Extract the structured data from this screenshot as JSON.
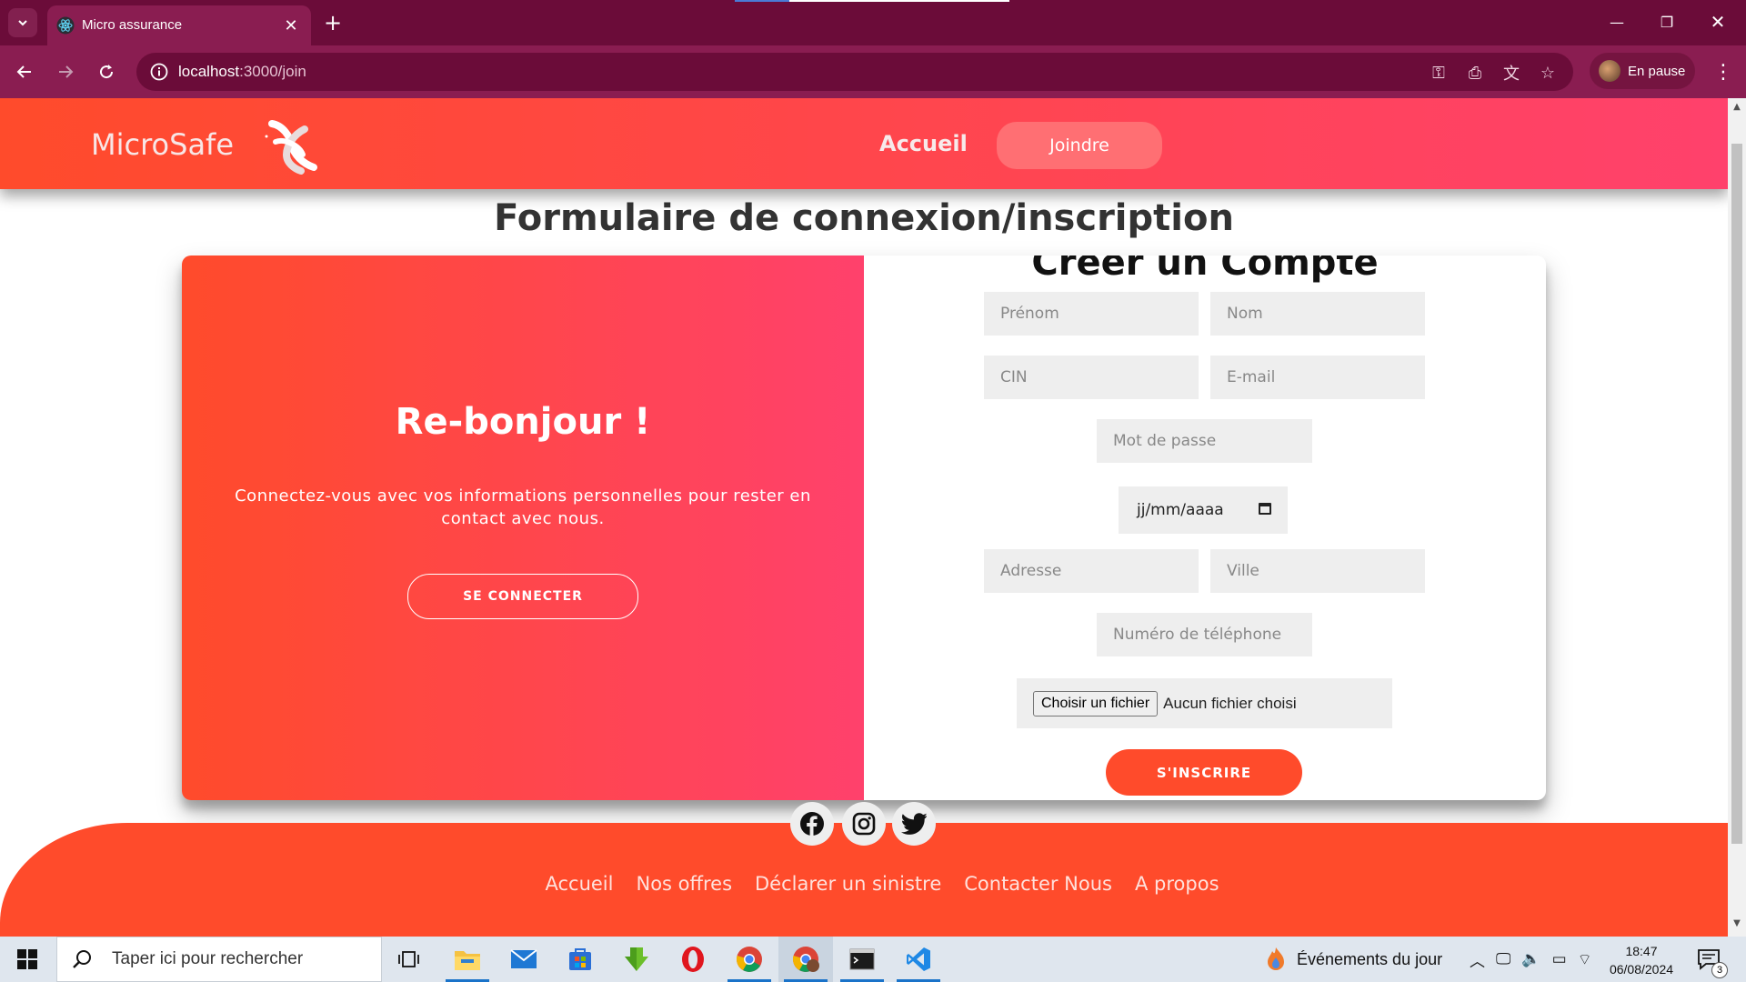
{
  "browser": {
    "tab_title": "Micro assurance",
    "url_host": "localhost",
    "url_path": ":3000/join",
    "profile_label": "En pause"
  },
  "header": {
    "brand": "MicroSafe",
    "nav_home": "Accueil",
    "nav_join": "Joindre"
  },
  "main": {
    "page_title": "Formulaire de connexion/inscription",
    "overlay": {
      "heading": "Re-bonjour !",
      "text": "Connectez-vous avec vos informations personnelles pour rester en contact avec nous.",
      "button": "SE CONNECTER"
    },
    "form": {
      "title": "Créer un Compte",
      "fields": {
        "prenom": "Prénom",
        "nom": "Nom",
        "cin": "CIN",
        "email": "E-mail",
        "password": "Mot de passe",
        "date": "jj/mm/aaaa",
        "adresse": "Adresse",
        "ville": "Ville",
        "phone": "Numéro de téléphone"
      },
      "file_button": "Choisir un fichier",
      "file_status": "Aucun fichier choisi",
      "submit": "S'INSCRIRE"
    }
  },
  "footer": {
    "links": [
      "Accueil",
      "Nos offres",
      "Déclarer un sinistre",
      "Contacter Nous",
      "A propos"
    ]
  },
  "taskbar": {
    "search_placeholder": "Taper ici pour rechercher",
    "news_label": "Événements du jour",
    "time": "18:47",
    "date": "06/08/2024",
    "notification_count": "3"
  },
  "colors": {
    "gradient_start": "#ff4b2b",
    "gradient_end": "#ff416c",
    "browser_frame": "#6b0c39"
  }
}
